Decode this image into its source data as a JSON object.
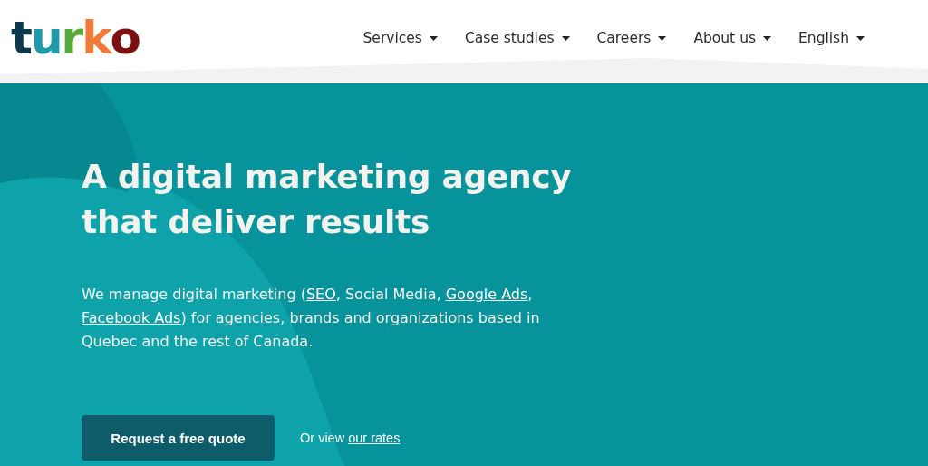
{
  "logo": {
    "text": "turko"
  },
  "nav": [
    {
      "label": "Services"
    },
    {
      "label": "Case studies"
    },
    {
      "label": "Careers"
    },
    {
      "label": "About us"
    },
    {
      "label": "English"
    }
  ],
  "hero": {
    "title_lines": [
      "A digital marketing agency",
      "that deliver results"
    ],
    "description": [
      {
        "kind": "text",
        "text": "We manage digital marketing ("
      },
      {
        "kind": "link",
        "text": "SEO"
      },
      {
        "kind": "text",
        "text": ", Social Media, "
      },
      {
        "kind": "link",
        "text": "Google Ads"
      },
      {
        "kind": "text",
        "text": ", "
      },
      {
        "kind": "link",
        "text": "Facebook Ads"
      },
      {
        "kind": "text",
        "text": ") for agencies, brands and organizations based in Quebec and the rest of Canada."
      }
    ],
    "cta_button": "Request a free quote",
    "rates_prefix": "Or view",
    "rates_link": "our rates"
  }
}
